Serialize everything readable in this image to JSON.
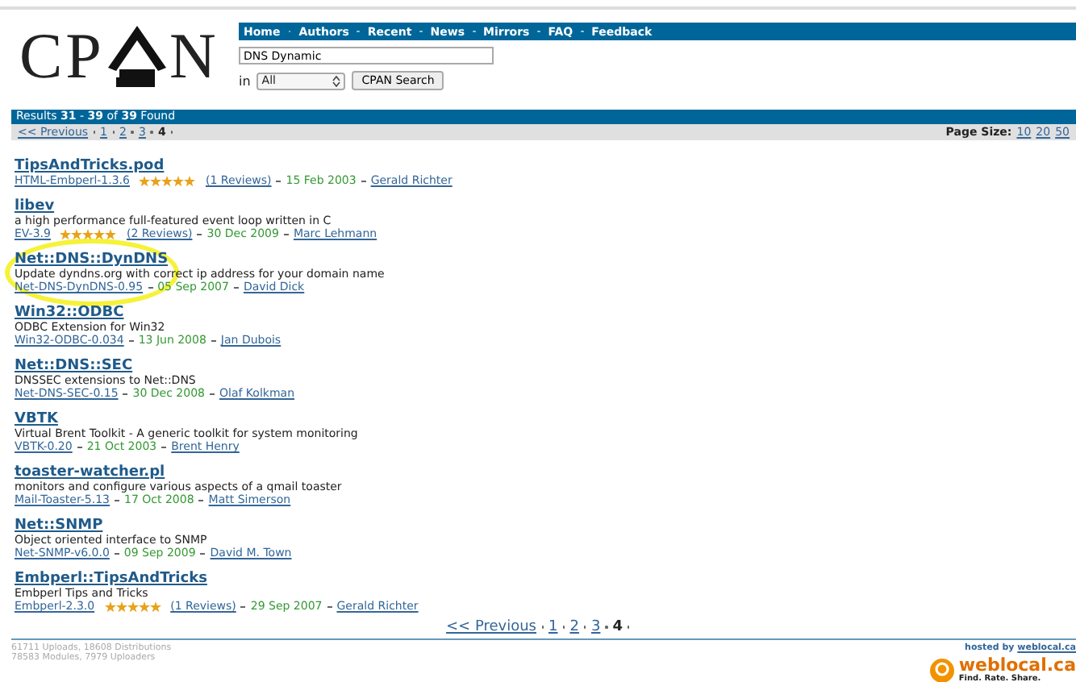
{
  "logo": {
    "left": "CP",
    "right": "N"
  },
  "nav": [
    "Home",
    "Authors",
    "Recent",
    "News",
    "Mirrors",
    "FAQ",
    "Feedback"
  ],
  "search": {
    "value": "DNS Dynamic",
    "scope_label": "in",
    "scope": "All",
    "button": "CPAN Search"
  },
  "results_bar": "Results **31** - **39** of **39** Found",
  "pager": {
    "previous": "<< Previous",
    "pages": [
      {
        "label": "1",
        "selected": false
      },
      {
        "label": "2",
        "selected": false
      },
      {
        "label": "3",
        "selected": false
      },
      {
        "label": "4",
        "selected": true
      }
    ]
  },
  "bottom_pager": {
    "previous": "<< Previous",
    "pages": [
      {
        "label": "1",
        "selected": false
      },
      {
        "label": "2",
        "selected": false
      },
      {
        "label": "3",
        "selected": false
      },
      {
        "label": "4",
        "selected": true
      }
    ]
  },
  "page_size": {
    "label": "Page Size:",
    "options": [
      "10",
      "20",
      "50"
    ]
  },
  "results": [
    {
      "title": "TipsAndTricks.pod",
      "dist": "HTML-Embperl-1.3.6",
      "stars": 5,
      "reviews": "(1 Reviews)",
      "date": "15 Feb 2003",
      "author": "Gerald Richter",
      "highlighted": false
    },
    {
      "title": "libev",
      "description": "a high performance full-featured event loop written in C",
      "dist": "EV-3.9",
      "stars": 5,
      "reviews": "(2 Reviews)",
      "date": "30 Dec 2009",
      "author": "Marc Lehmann",
      "highlighted": false
    },
    {
      "title": "Net::DNS::DynDNS",
      "description": "Update dyndns.org with correct ip address for your domain name",
      "dist": "Net-DNS-DynDNS-0.95",
      "date": "05 Sep 2007",
      "author": "David Dick",
      "highlighted": true
    },
    {
      "title": "Win32::ODBC",
      "description": "ODBC Extension for Win32",
      "dist": "Win32-ODBC-0.034",
      "date": "13 Jun 2008",
      "author": "Jan Dubois",
      "highlighted": false
    },
    {
      "title": "Net::DNS::SEC",
      "description": "DNSSEC extensions to Net::DNS",
      "dist": "Net-DNS-SEC-0.15",
      "date": "30 Dec 2008",
      "author": "Olaf Kolkman",
      "highlighted": false
    },
    {
      "title": "VBTK",
      "description": "Virtual Brent Toolkit - A generic toolkit for system monitoring",
      "dist": "VBTK-0.20",
      "date": "21 Oct 2003",
      "author": "Brent Henry",
      "highlighted": false
    },
    {
      "title": "toaster-watcher.pl",
      "description": "monitors and configure various aspects of a qmail toaster",
      "dist": "Mail-Toaster-5.13",
      "date": "17 Oct 2008",
      "author": "Matt Simerson",
      "highlighted": false
    },
    {
      "title": "Net::SNMP",
      "description": "Object oriented interface to SNMP",
      "dist": "Net-SNMP-v6.0.0",
      "date": "09 Sep 2009",
      "author": "David M. Town",
      "highlighted": false
    },
    {
      "title": "Embperl::TipsAndTricks",
      "description": "Embperl Tips and Tricks",
      "dist": "Embperl-2.3.0",
      "stars": 5,
      "reviews": "(1 Reviews)",
      "date": "29 Sep 2007",
      "author": "Gerald Richter",
      "highlighted": false
    }
  ],
  "footer": {
    "stats": [
      "61711 Uploads, 18608 Distributions",
      "78583 Modules, 7979 Uploaders"
    ],
    "hosted_by": "hosted by",
    "host": "weblocal.ca",
    "host_logo": "weblocal.ca",
    "tagline": "Find. Rate. Share."
  }
}
